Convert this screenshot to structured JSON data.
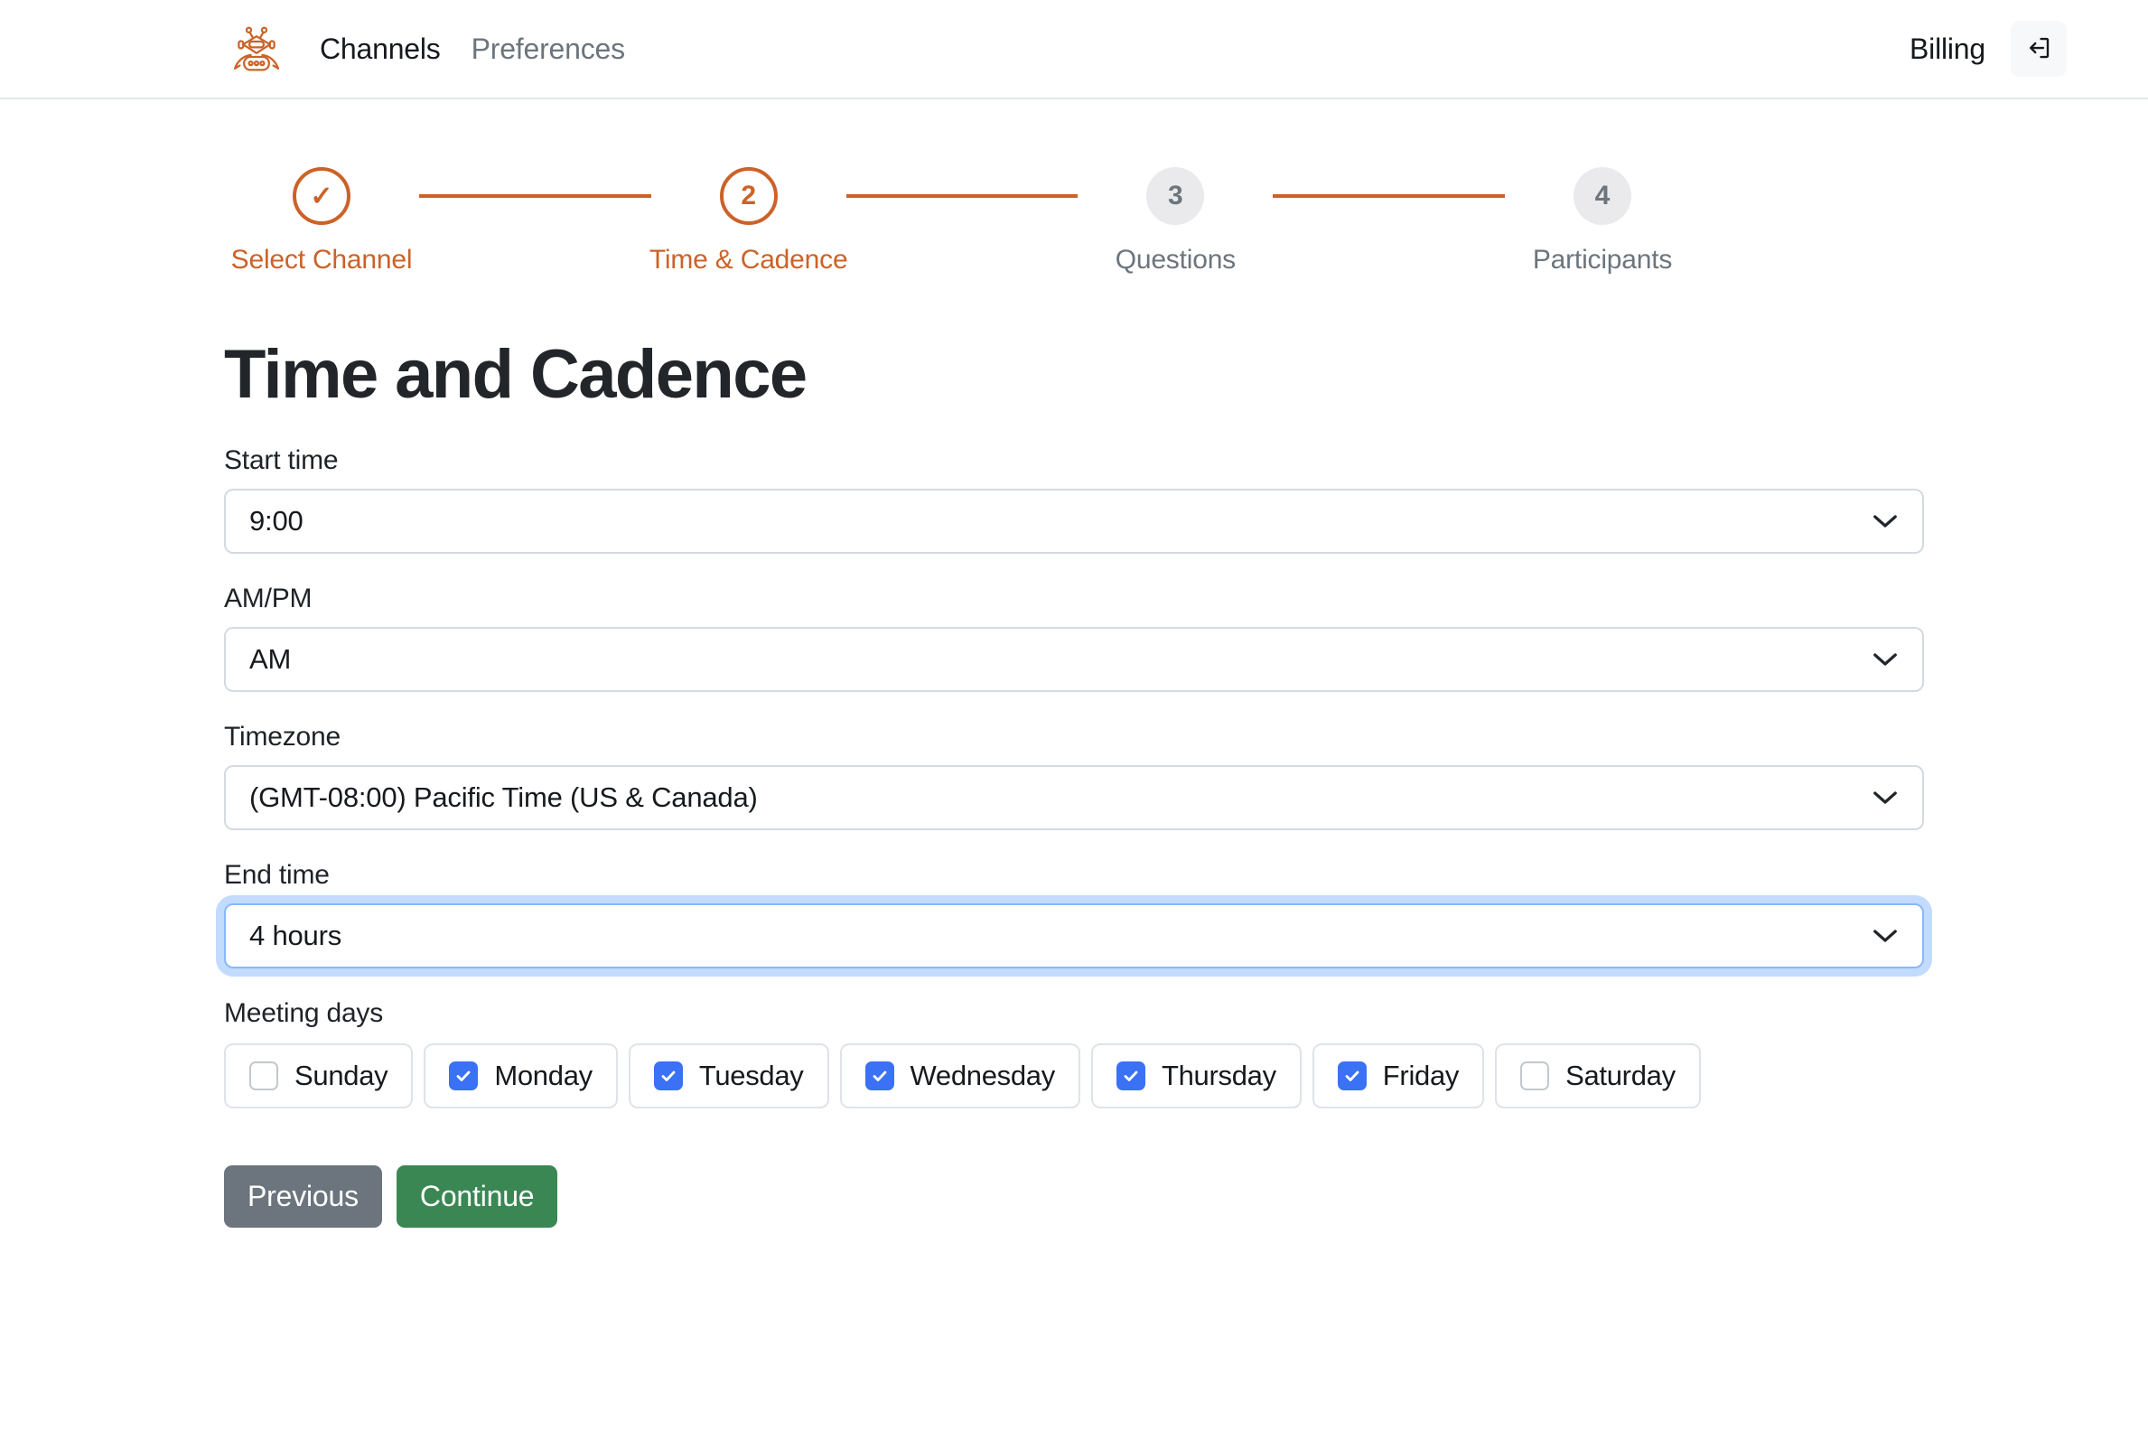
{
  "header": {
    "logo_icon": "robot-logo-icon",
    "nav": [
      {
        "label": "Channels",
        "active": true
      },
      {
        "label": "Preferences",
        "active": false
      }
    ],
    "billing_label": "Billing",
    "logout_icon": "logout-icon"
  },
  "stepper": {
    "steps": [
      {
        "number": "✓",
        "label": "Select Channel",
        "state": "done"
      },
      {
        "number": "2",
        "label": "Time & Cadence",
        "state": "current"
      },
      {
        "number": "3",
        "label": "Questions",
        "state": "upcoming"
      },
      {
        "number": "4",
        "label": "Participants",
        "state": "upcoming"
      }
    ]
  },
  "main": {
    "title": "Time and Cadence",
    "fields": {
      "start_time": {
        "label": "Start time",
        "value": "9:00"
      },
      "am_pm": {
        "label": "AM/PM",
        "value": "AM"
      },
      "timezone": {
        "label": "Timezone",
        "value": "(GMT-08:00) Pacific Time (US & Canada)"
      },
      "end_time": {
        "label": "End time",
        "value": "4 hours",
        "focused": true
      }
    },
    "meeting_days": {
      "label": "Meeting days",
      "days": [
        {
          "label": "Sunday",
          "checked": false
        },
        {
          "label": "Monday",
          "checked": true
        },
        {
          "label": "Tuesday",
          "checked": true
        },
        {
          "label": "Wednesday",
          "checked": true
        },
        {
          "label": "Thursday",
          "checked": true
        },
        {
          "label": "Friday",
          "checked": true
        },
        {
          "label": "Saturday",
          "checked": false
        }
      ]
    },
    "actions": {
      "previous_label": "Previous",
      "continue_label": "Continue"
    }
  },
  "colors": {
    "brand_orange": "#cc6228",
    "checkbox_blue": "#3b71f5",
    "focus_blue": "#86b7fe",
    "continue_green": "#3a8754",
    "previous_gray": "#6c757d"
  }
}
